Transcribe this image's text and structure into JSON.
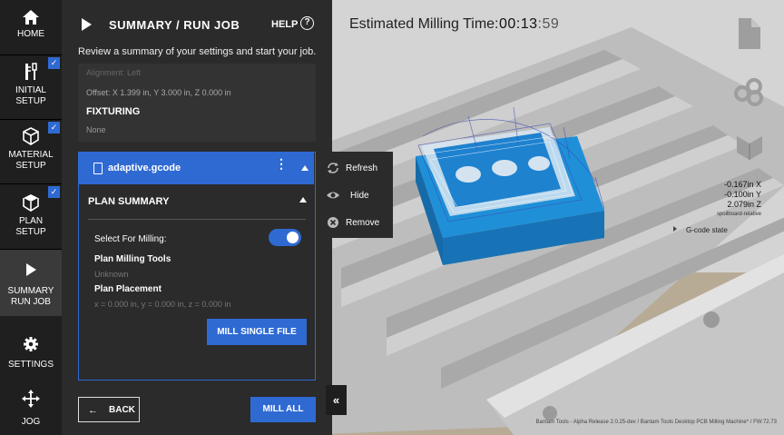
{
  "nav": {
    "items": [
      {
        "label": "HOME",
        "icon": "home-icon",
        "checked": false
      },
      {
        "label": "INITIAL SETUP",
        "icon": "tools-icon",
        "checked": true
      },
      {
        "label": "MATERIAL SETUP",
        "icon": "cube-icon",
        "checked": true
      },
      {
        "label": "PLAN SETUP",
        "icon": "stack-icon",
        "checked": true
      },
      {
        "label": "SUMMARY RUN JOB",
        "icon": "play-icon",
        "checked": false
      },
      {
        "label": "SETTINGS",
        "icon": "gear-icon",
        "checked": false
      },
      {
        "label": "JOG",
        "icon": "move-arrows-icon",
        "checked": false
      }
    ],
    "check_glyph": "✓"
  },
  "panel": {
    "title": "SUMMARY / RUN JOB",
    "help": "HELP",
    "help_glyph": "?",
    "subtitle": "Review a summary of your settings and start your job.",
    "alignment_faded": "Alignment: Left",
    "offset": "Offset: X 1.399 in, Y 3.000 in, Z 0.000 in",
    "fixturing_heading": "FIXTURING",
    "fixturing_value": "None"
  },
  "file": {
    "name": "adaptive.gcode",
    "kebab": "⋮",
    "plan_summary": "PLAN SUMMARY",
    "select_for_milling": "Select For Milling:",
    "select_for_milling_on": true,
    "plan_milling_tools": "Plan Milling Tools",
    "plan_milling_tools_value": "Unknown",
    "plan_placement": "Plan Placement",
    "plan_placement_value": "x = 0.000 in, y = 0.000 in, z = 0.000 in",
    "mill_single": "MILL SINGLE FILE"
  },
  "actions": {
    "back": "BACK",
    "back_arrow": "←",
    "mill_all": "MILL ALL"
  },
  "menu": {
    "items": [
      {
        "label": "Refresh",
        "icon": "refresh-icon"
      },
      {
        "label": "Hide",
        "icon": "eye-icon"
      },
      {
        "label": "Remove",
        "icon": "remove-icon"
      }
    ]
  },
  "collapse": "«",
  "viewport": {
    "est_label": "Estimated Milling Time:",
    "est_time_main": "00:13",
    "est_time_sec": ":59",
    "coord_x": "-0.167in X",
    "coord_y": "-0.100in Y",
    "coord_z": "2.079in Z",
    "coord_rel": "spoilboard-relative",
    "gcode_state": "G-code state",
    "footer": "Bantam Tools - Alpha Release 2.0.25-dev / Bantam Tools Desktop PCB Milling Machine* / FW:72.73",
    "tool_icons": [
      "file-icon",
      "toolpath-rings-icon",
      "stock-box-icon"
    ]
  },
  "colors": {
    "accent": "#2f6ad3",
    "nav_bg": "#1f1f1f",
    "panel_bg": "#2b2b2b",
    "stock": "#1e8ed8"
  }
}
